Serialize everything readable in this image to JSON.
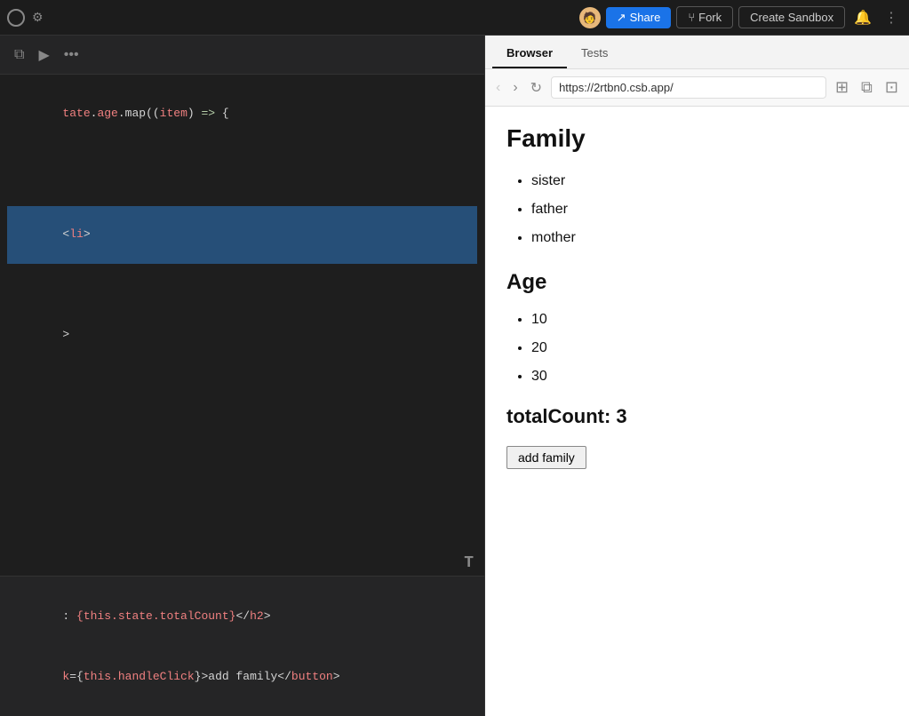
{
  "header": {
    "share_label": "Share",
    "fork_label": "Fork",
    "create_sandbox_label": "Create Sandbox",
    "url_bar": "https://2rtbn0.csb.app/",
    "avatar_text": "👤"
  },
  "editor": {
    "toolbar_icons": [
      "split-horizontal",
      "preview",
      "more"
    ]
  },
  "browser": {
    "tabs": [
      {
        "label": "Browser",
        "active": true
      },
      {
        "label": "Tests",
        "active": false
      }
    ],
    "address": "https://2rtbn0.csb.app/",
    "content": {
      "family_heading": "Family",
      "family_items": [
        "sister",
        "father",
        "mother"
      ],
      "age_heading": "Age",
      "age_items": [
        "10",
        "20",
        "30"
      ],
      "total_count_label": "totalCount: 3",
      "add_button_label": "add family"
    }
  },
  "code": {
    "lines": [
      "tate.age.map((item) => {",
      "",
      "",
      "",
      "li>"
    ],
    "bottom_lines": [
      ": {this.state.totalCount}</h2>",
      "k={this.handleClick}>add family</button>"
    ]
  }
}
